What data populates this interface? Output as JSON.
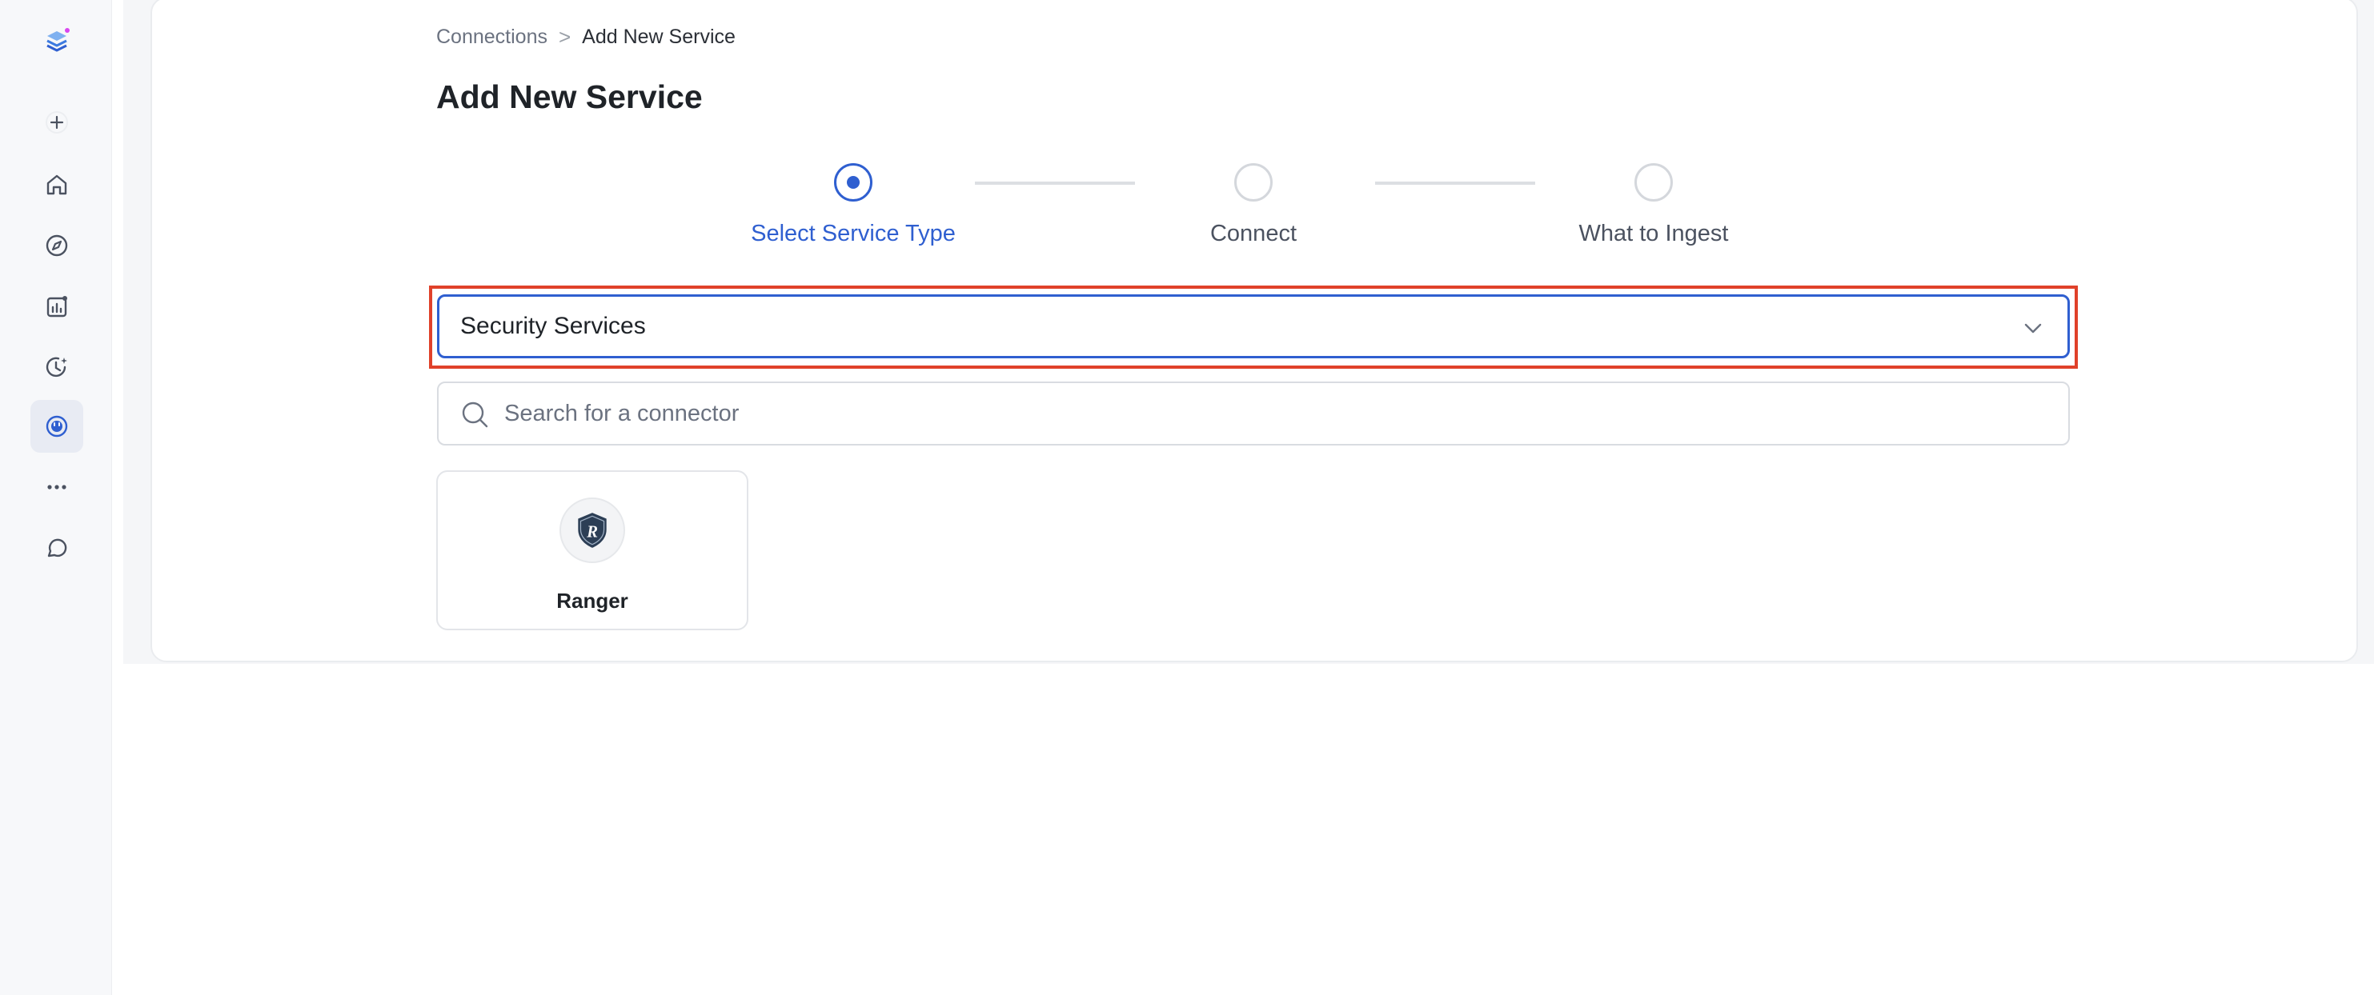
{
  "breadcrumb": {
    "parent": "Connections",
    "separator": ">",
    "current": "Add New Service"
  },
  "page": {
    "title": "Add New Service"
  },
  "stepper": {
    "steps": [
      {
        "label": "Select Service Type",
        "state": "active"
      },
      {
        "label": "Connect",
        "state": "pending"
      },
      {
        "label": "What to Ingest",
        "state": "pending"
      }
    ]
  },
  "service_type_select": {
    "selected": "Security Services"
  },
  "search": {
    "placeholder": "Search for a connector",
    "value": ""
  },
  "connectors": [
    {
      "name": "Ranger",
      "logo_letter": "R",
      "icon": "ranger-shield-icon"
    }
  ],
  "sidebar": {
    "items": [
      {
        "icon": "logo-icon"
      },
      {
        "icon": "plus-icon"
      },
      {
        "icon": "home-icon"
      },
      {
        "icon": "explore-compass-icon"
      },
      {
        "icon": "insights-chart-icon"
      },
      {
        "icon": "observability-clock-icon"
      },
      {
        "icon": "settings-plug-icon",
        "active": true
      },
      {
        "icon": "more-dots-icon"
      },
      {
        "icon": "chat-bubble-icon"
      }
    ]
  },
  "colors": {
    "accent": "#2f5fd0",
    "highlight": "#e0412a",
    "text": "#1f2328",
    "muted": "#6b7280"
  }
}
